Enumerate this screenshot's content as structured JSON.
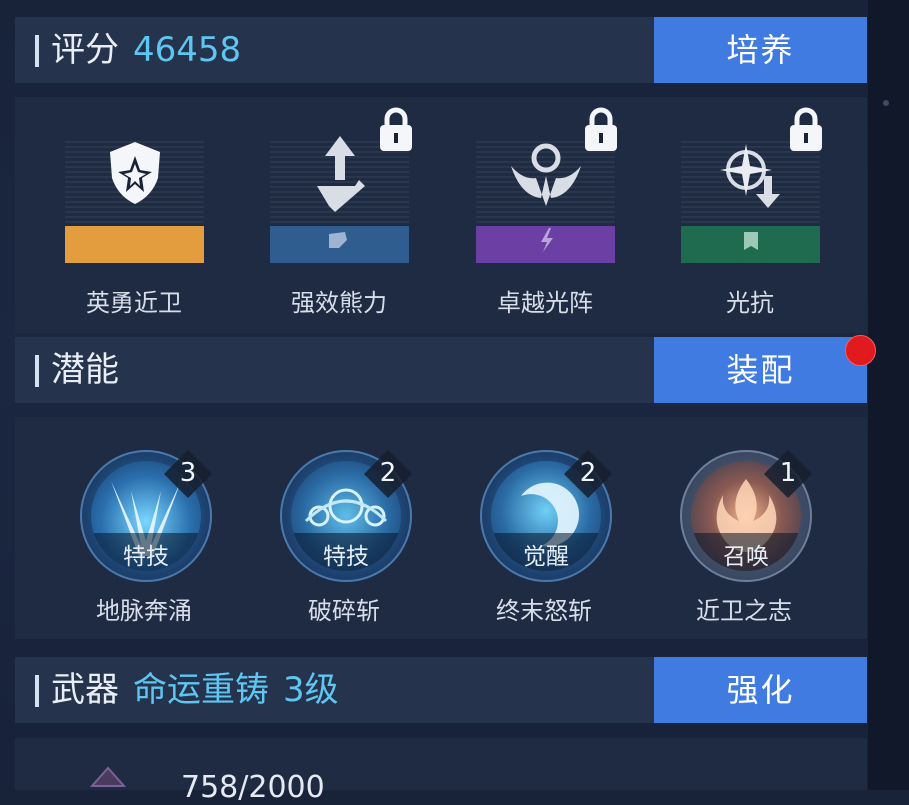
{
  "score": {
    "label": "评分",
    "value": "46458",
    "button": "培养"
  },
  "talents": [
    {
      "name": "英勇近卫",
      "locked": false,
      "color": "#e49d3e",
      "icon": "shield-icon"
    },
    {
      "name": "强效熊力",
      "locked": true,
      "color": "#2f5d8f",
      "icon": "arrow-up-icon"
    },
    {
      "name": "卓越光阵",
      "locked": true,
      "color": "#6b3fa3",
      "icon": "crest-icon"
    },
    {
      "name": "光抗",
      "locked": true,
      "color": "#1f6b4f",
      "icon": "compass-icon"
    }
  ],
  "potential": {
    "label": "潜能",
    "button": "装配"
  },
  "skills": [
    {
      "name": "地脉奔涌",
      "type": "特技",
      "count": "3"
    },
    {
      "name": "破碎斩",
      "type": "特技",
      "count": "2"
    },
    {
      "name": "终末怒斩",
      "type": "觉醒",
      "count": "2"
    },
    {
      "name": "近卫之志",
      "type": "召唤",
      "count": "1"
    }
  ],
  "weapon": {
    "label": "武器",
    "name": "命运重铸",
    "level": "3级",
    "button": "强化"
  },
  "progress": {
    "text": "758/2000"
  }
}
